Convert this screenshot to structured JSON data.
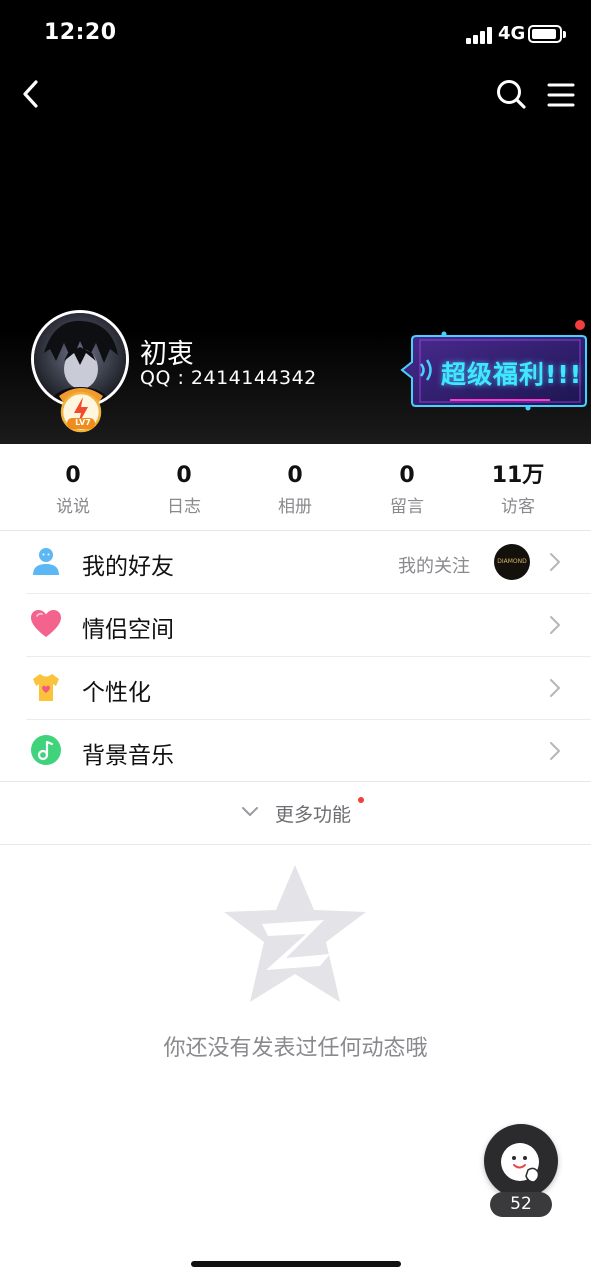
{
  "status_bar": {
    "time": "12:20",
    "network": "4G"
  },
  "profile": {
    "name": "初衷",
    "qq": "QQ : 2414144342",
    "level": "LV7"
  },
  "promo": {
    "text": "超级福利!!!"
  },
  "stats": [
    {
      "value": "0",
      "label": "说说"
    },
    {
      "value": "0",
      "label": "日志"
    },
    {
      "value": "0",
      "label": "相册"
    },
    {
      "value": "0",
      "label": "留言"
    },
    {
      "value": "11万",
      "label": "访客"
    }
  ],
  "menu": {
    "friends": {
      "label": "我的好友",
      "sub": "我的关注",
      "follow_avatar_text": "DIAMOND"
    },
    "couple": {
      "label": "情侣空间"
    },
    "personalize": {
      "label": "个性化"
    },
    "music": {
      "label": "背景音乐"
    },
    "more": {
      "label": "更多功能"
    }
  },
  "empty_state": {
    "text": "你还没有发表过任何动态哦"
  },
  "fab": {
    "count": "52"
  },
  "colors": {
    "header_bg": "#000000",
    "accent_red": "#f23d3d",
    "promo_cyan": "#3ee8ff"
  }
}
